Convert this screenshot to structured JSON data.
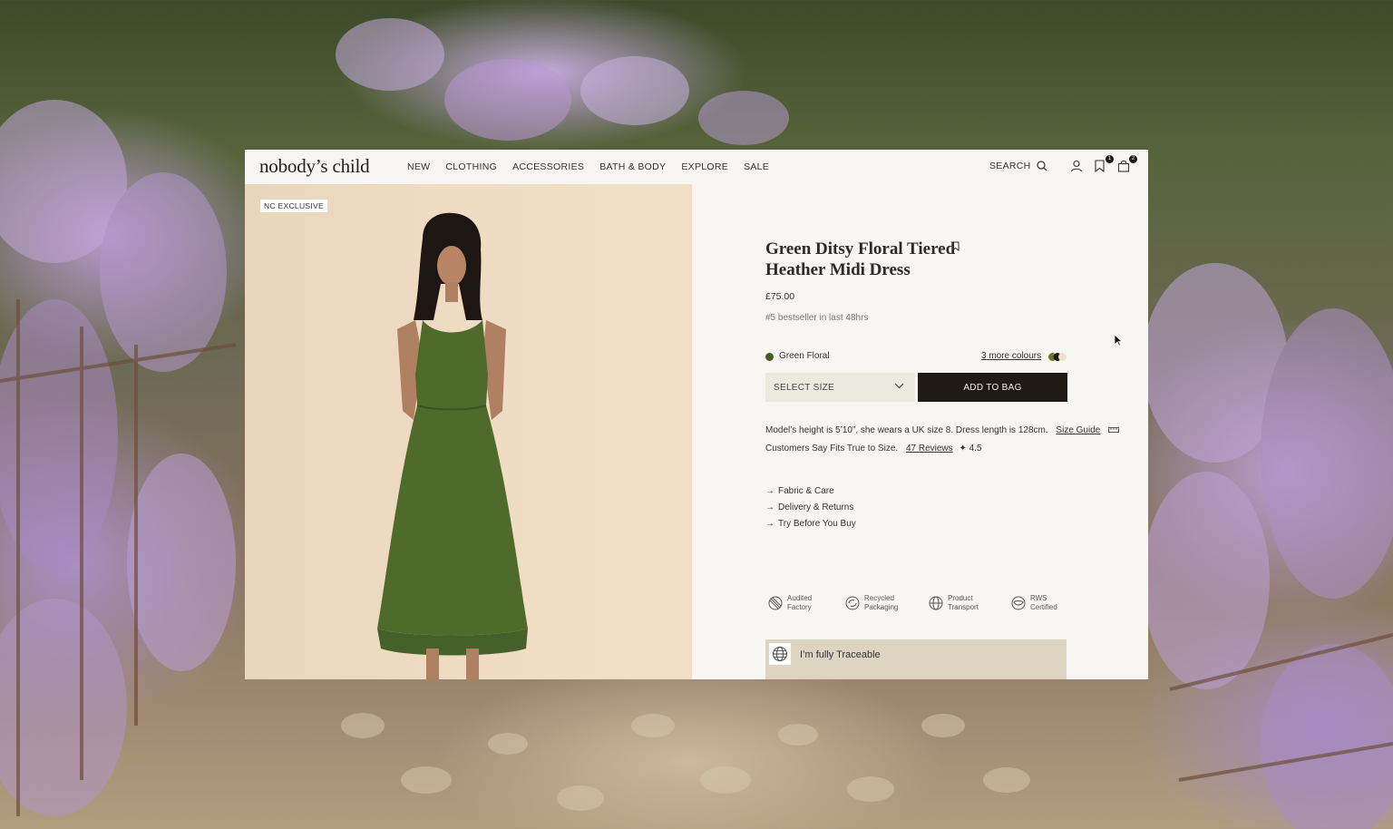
{
  "brand": {
    "logo": "nobody’s child"
  },
  "nav": {
    "items": [
      {
        "label": "NEW"
      },
      {
        "label": "CLOTHING"
      },
      {
        "label": "ACCESSORIES"
      },
      {
        "label": "BATH & BODY"
      },
      {
        "label": "EXPLORE"
      },
      {
        "label": "SALE"
      }
    ],
    "search_label": "SEARCH",
    "icons": [
      "search-icon",
      "account-icon",
      "wishlist-icon",
      "bag-icon"
    ],
    "wishlist_count": "1",
    "bag_count": "2"
  },
  "image": {
    "badge": "NC EXCLUSIVE",
    "description_icon": "model-dress-photo"
  },
  "product": {
    "title": "Green Ditsy Floral Tiered Heather Midi Dress",
    "price": "£75.00",
    "bestseller": "#5 bestseller in last 48hrs",
    "colour": {
      "name": "Green Floral",
      "swatch": "#4a5a26"
    },
    "more_colours": "3 more colours",
    "select_size": "SELECT SIZE",
    "add_to_bag": "ADD TO BAG",
    "model_info": "Model’s height is 5’10”, she wears a UK size 8. Dress length is 128cm.",
    "size_guide": "Size Guide",
    "fits_text": "Customers Say Fits True to Size.",
    "reviews": "47 Reviews",
    "rating": "4.5",
    "accordion": [
      {
        "label": "Fabric & Care"
      },
      {
        "label": "Delivery & Returns"
      },
      {
        "label": "Try Before You Buy"
      }
    ],
    "certifications": [
      {
        "line1": "Audited",
        "line2": "Factory"
      },
      {
        "line1": "Recycled",
        "line2": "Packaging"
      },
      {
        "line1": "Product",
        "line2": "Transport"
      },
      {
        "line1": "RWS",
        "line2": "Certified"
      }
    ],
    "traceable": "I’m fully Traceable"
  },
  "colors": {
    "accent_dark": "#1f1b14",
    "page_bg": "#f7f6f2",
    "traceable_bg": "#ddd4c2",
    "select_bg": "#ece9df"
  }
}
